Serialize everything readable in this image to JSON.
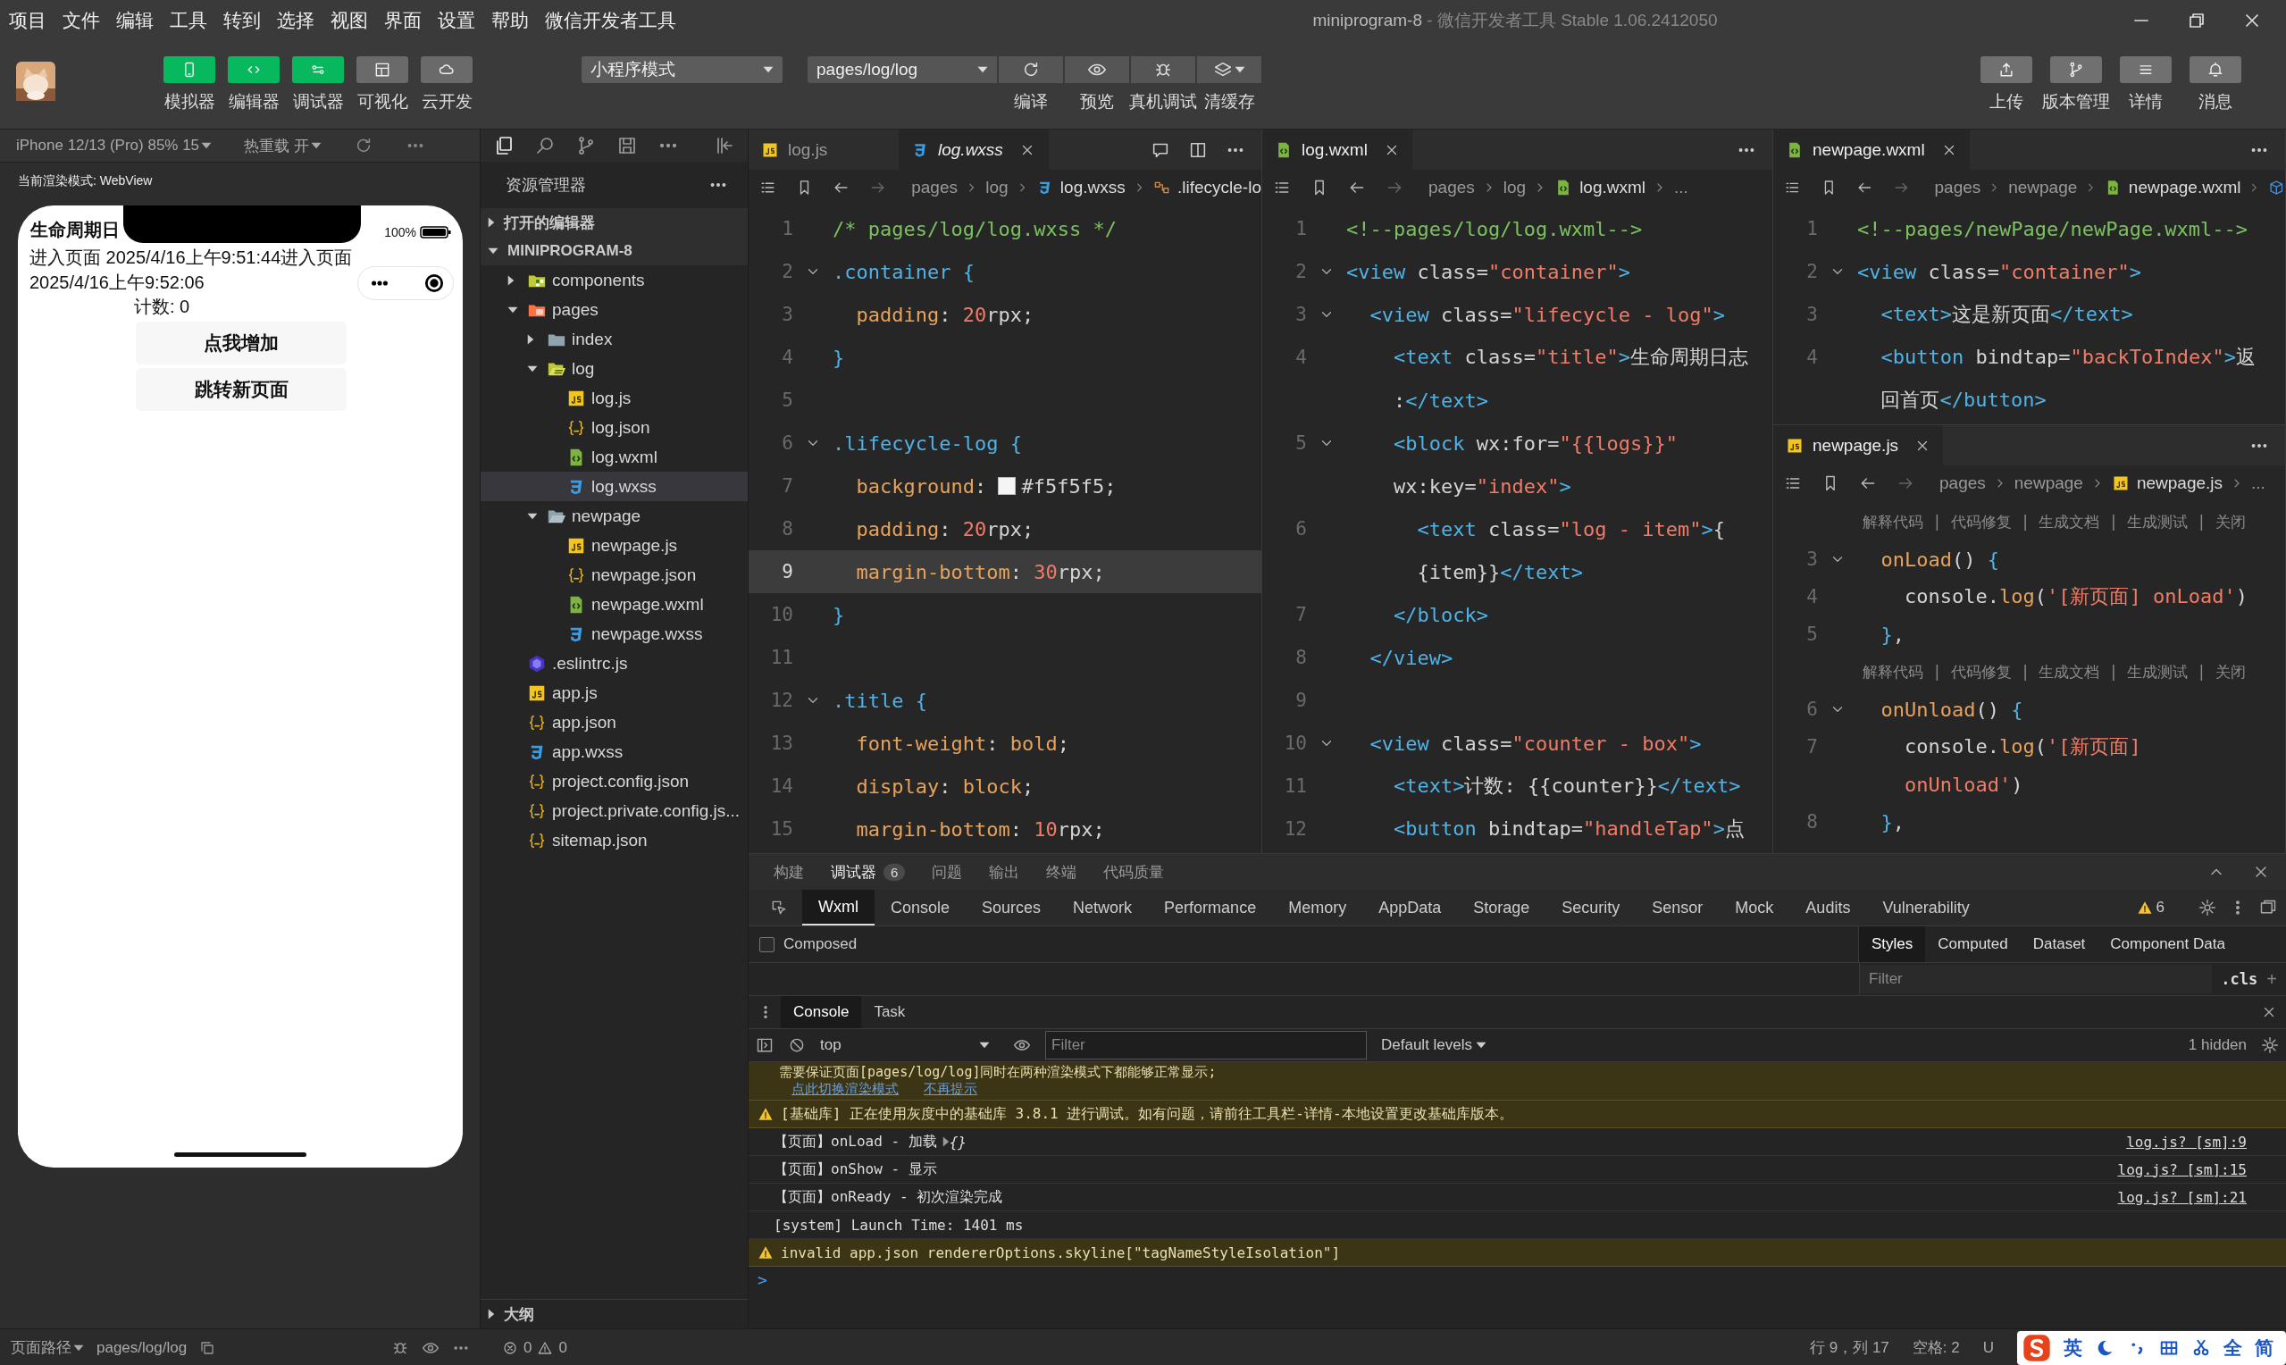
{
  "menu": [
    "项目",
    "文件",
    "编辑",
    "工具",
    "转到",
    "选择",
    "视图",
    "界面",
    "设置",
    "帮助",
    "微信开发者工具"
  ],
  "window": {
    "title": "miniprogram-8",
    "subtitle": " - 微信开发者工具 Stable 1.06.2412050"
  },
  "toolbar": {
    "tools": [
      {
        "label": "模拟器",
        "kind": "phone",
        "active": true
      },
      {
        "label": "编辑器",
        "kind": "code",
        "active": true
      },
      {
        "label": "调试器",
        "kind": "debug",
        "active": true
      },
      {
        "label": "可视化",
        "kind": "layout",
        "active": false
      },
      {
        "label": "云开发",
        "kind": "cloud",
        "active": false
      }
    ],
    "mode": "小程序模式",
    "page": "pages/log/log",
    "actions": [
      {
        "label": "编译",
        "kind": "refresh",
        "dropdown": false
      },
      {
        "label": "预览",
        "kind": "eye",
        "dropdown": false
      },
      {
        "label": "真机调试",
        "kind": "bug",
        "dropdown": false
      },
      {
        "label": "清缓存",
        "kind": "layers",
        "dropdown": true
      }
    ],
    "right": [
      {
        "label": "上传",
        "kind": "upload"
      },
      {
        "label": "版本管理",
        "kind": "branch"
      },
      {
        "label": "详情",
        "kind": "menu"
      },
      {
        "label": "消息",
        "kind": "bell"
      }
    ]
  },
  "simulator": {
    "device": "iPhone 12/13 (Pro) 85% 15",
    "hot_reload": "热重载 开",
    "render_mode": "当前渲染模式: WebView",
    "phone": {
      "title": "生命周期日",
      "battery": "100%",
      "log": "进入页面 2025/4/16上午9:51:44进入页面 2025/4/16上午9:52:06",
      "counter": "计数: 0",
      "buttons": [
        "点我增加",
        "跳转新页面"
      ]
    }
  },
  "explorer": {
    "title": "资源管理器",
    "sections": [
      {
        "label": "打开的编辑器",
        "expanded": false
      },
      {
        "label": "MINIPROGRAM-8",
        "expanded": true
      }
    ],
    "tree": [
      {
        "name": "components",
        "kind": "folder-components",
        "expanded": false,
        "selected": false
      },
      {
        "name": "pages",
        "kind": "folder-pages",
        "expanded": true,
        "selected": false,
        "children": [
          {
            "name": "index",
            "kind": "folder",
            "expanded": false,
            "selected": false
          },
          {
            "name": "log",
            "kind": "folder-logs",
            "expanded": true,
            "selected": false,
            "children": [
              {
                "name": "log.js",
                "kind": "js",
                "selected": false
              },
              {
                "name": "log.json",
                "kind": "json",
                "selected": false
              },
              {
                "name": "log.wxml",
                "kind": "wxml",
                "selected": false
              },
              {
                "name": "log.wxss",
                "kind": "wxss",
                "selected": true
              }
            ]
          },
          {
            "name": "newpage",
            "kind": "folder",
            "expanded": true,
            "selected": false,
            "children": [
              {
                "name": "newpage.js",
                "kind": "js",
                "selected": false
              },
              {
                "name": "newpage.json",
                "kind": "json",
                "selected": false
              },
              {
                "name": "newpage.wxml",
                "kind": "wxml",
                "selected": false
              },
              {
                "name": "newpage.wxss",
                "kind": "wxss",
                "selected": false
              }
            ]
          }
        ]
      },
      {
        "name": ".eslintrc.js",
        "kind": "eslint",
        "selected": false
      },
      {
        "name": "app.js",
        "kind": "js",
        "selected": false
      },
      {
        "name": "app.json",
        "kind": "json",
        "selected": false
      },
      {
        "name": "app.wxss",
        "kind": "wxss",
        "selected": false
      },
      {
        "name": "project.config.json",
        "kind": "json",
        "selected": false
      },
      {
        "name": "project.private.config.js...",
        "kind": "json",
        "selected": false
      },
      {
        "name": "sitemap.json",
        "kind": "json",
        "selected": false
      }
    ],
    "outline": {
      "label": "大纲",
      "expanded": false
    }
  },
  "editor_groups": [
    {
      "panes": [
        {
          "kind": "css",
          "tabs": [
            {
              "label": "log.js",
              "kind": "js",
              "selected": false,
              "preview": false,
              "closable": false
            },
            {
              "label": "log.wxss",
              "kind": "wxss",
              "selected": true,
              "preview": true,
              "closable": true
            }
          ],
          "breadcrumb": [
            {
              "text": "pages"
            },
            {
              "text": "log"
            },
            {
              "text": "log.wxss",
              "kind": "wxss"
            },
            {
              "text": ".lifecycle-lo",
              "kind": "symbol"
            }
          ],
          "lines": [
            {
              "n": "1",
              "fold": false,
              "current": false,
              "text": "/* pages/log/log.wxss */"
            },
            {
              "n": "2",
              "fold": true,
              "current": false,
              "text": ".container {"
            },
            {
              "n": "3",
              "fold": false,
              "current": false,
              "text": "  padding: 20rpx;"
            },
            {
              "n": "4",
              "fold": false,
              "current": false,
              "text": "}"
            },
            {
              "n": "5",
              "fold": false,
              "current": false
            },
            {
              "n": "6",
              "fold": true,
              "current": false,
              "text": ".lifecycle-log {"
            },
            {
              "n": "7",
              "fold": false,
              "current": false,
              "text": "  background: #f5f5f5;"
            },
            {
              "n": "8",
              "fold": false,
              "current": false,
              "text": "  padding: 20rpx;"
            },
            {
              "n": "9",
              "fold": false,
              "current": true,
              "text": "  margin-bottom: 30rpx;"
            },
            {
              "n": "10",
              "fold": false,
              "current": false,
              "text": "}"
            },
            {
              "n": "11",
              "fold": false,
              "current": false
            },
            {
              "n": "12",
              "fold": true,
              "current": false,
              "text": ".title {"
            },
            {
              "n": "13",
              "fold": false,
              "current": false,
              "text": "  font-weight: bold;"
            },
            {
              "n": "14",
              "fold": false,
              "current": false,
              "text": "  display: block;"
            },
            {
              "n": "15",
              "fold": false,
              "current": false,
              "text": "  margin-bottom: 10rpx;"
            }
          ]
        }
      ]
    },
    {
      "panes": [
        {
          "kind": "xml",
          "tabs": [
            {
              "label": "log.wxml",
              "kind": "wxml",
              "selected": true,
              "preview": false,
              "closable": true
            }
          ],
          "breadcrumb": [
            {
              "text": "pages"
            },
            {
              "text": "log"
            },
            {
              "text": "log.wxml",
              "kind": "wxml"
            },
            {
              "text": "..."
            }
          ],
          "lines": [
            {
              "n": "1",
              "fold": false,
              "text": "<!--pages/log/log.wxml-->"
            },
            {
              "n": "2",
              "fold": true,
              "text": "<view class=\"container\">"
            },
            {
              "n": "3",
              "fold": true,
              "text": "  <view class=\"lifecycle - log\">"
            },
            {
              "n": "4",
              "fold": false,
              "text": "    <text class=\"title\">生命周期日志"
            },
            {
              "fold": false,
              "text": "    :</text>"
            },
            {
              "n": "5",
              "fold": true,
              "text": "    <block wx:for=\"{{logs}}\""
            },
            {
              "fold": false,
              "text": "    wx:key=\"index\">"
            },
            {
              "n": "6",
              "fold": false,
              "text": "      <text class=\"log - item\">{"
            },
            {
              "fold": false,
              "text": "      {item}}</text>"
            },
            {
              "n": "7",
              "fold": false,
              "text": "    </block>"
            },
            {
              "n": "8",
              "fold": false,
              "text": "  </view>"
            },
            {
              "n": "9",
              "fold": false
            },
            {
              "n": "10",
              "fold": true,
              "text": "  <view class=\"counter - box\">"
            },
            {
              "n": "11",
              "fold": false,
              "text": "    <text>计数: {{counter}}</text>"
            },
            {
              "n": "12",
              "fold": false,
              "text": "    <button bindtap=\"handleTap\">点"
            }
          ]
        }
      ]
    },
    {
      "panes": [
        {
          "kind": "xml",
          "tabs": [
            {
              "label": "newpage.wxml",
              "kind": "wxml",
              "selected": true,
              "preview": false,
              "closable": true
            }
          ],
          "breadcrumb": [
            {
              "text": "pages"
            },
            {
              "text": "newpage"
            },
            {
              "text": "newpage.wxml",
              "kind": "wxml"
            },
            {
              "kind": "cube"
            }
          ],
          "lines": [
            {
              "n": "1",
              "fold": false,
              "text": "<!--pages/newPage/newPage.wxml-->"
            },
            {
              "n": "2",
              "fold": true,
              "text": "<view class=\"container\">"
            },
            {
              "n": "3",
              "fold": false,
              "text": "  <text>这是新页面</text>"
            },
            {
              "n": "4",
              "fold": false,
              "text": "  <button bindtap=\"backToIndex\">返"
            },
            {
              "fold": false,
              "text": "  回首页</button>"
            }
          ]
        },
        {
          "kind": "js",
          "tabs": [
            {
              "label": "newpage.js",
              "kind": "js",
              "selected": true,
              "preview": false,
              "closable": true
            }
          ],
          "breadcrumb": [
            {
              "text": "pages"
            },
            {
              "text": "newpage"
            },
            {
              "text": "newpage.js",
              "kind": "js"
            },
            {
              "text": "..."
            }
          ],
          "lines": [
            {
              "kind": "lens",
              "text": "解释代码 | 代码修复 | 生成文档 | 生成测试 | 关闭"
            },
            {
              "kind": "code",
              "n": "3",
              "fold": true,
              "text": "  onLoad() {"
            },
            {
              "kind": "code",
              "n": "4",
              "fold": false,
              "text": "    console.log('[新页面] onLoad')"
            },
            {
              "kind": "code",
              "n": "5",
              "fold": false,
              "text": "  },"
            },
            {
              "kind": "lens",
              "text": "解释代码 | 代码修复 | 生成文档 | 生成测试 | 关闭"
            },
            {
              "kind": "code",
              "n": "6",
              "fold": true,
              "text": "  onUnload() {"
            },
            {
              "kind": "code",
              "n": "7",
              "fold": false,
              "text": "    console.log('[新页面]"
            },
            {
              "kind": "code",
              "fold": false,
              "text": "    onUnload')"
            },
            {
              "kind": "code",
              "n": "8",
              "fold": false,
              "text": "  },"
            }
          ]
        }
      ]
    }
  ],
  "panel": {
    "tabs": [
      {
        "label": "构建",
        "selected": false
      },
      {
        "label": "调试器",
        "selected": true,
        "badge": "6"
      },
      {
        "label": "问题",
        "selected": false
      },
      {
        "label": "输出",
        "selected": false
      },
      {
        "label": "终端",
        "selected": false
      },
      {
        "label": "代码质量",
        "selected": false
      }
    ],
    "devtools": {
      "tabs": [
        {
          "label": "Wxml",
          "selected": true
        },
        {
          "label": "Console",
          "selected": false
        },
        {
          "label": "Sources",
          "selected": false
        },
        {
          "label": "Network",
          "selected": false
        },
        {
          "label": "Performance",
          "selected": false
        },
        {
          "label": "Memory",
          "selected": false
        },
        {
          "label": "AppData",
          "selected": false
        },
        {
          "label": "Storage",
          "selected": false
        },
        {
          "label": "Security",
          "selected": false
        },
        {
          "label": "Sensor",
          "selected": false
        },
        {
          "label": "Mock",
          "selected": false
        },
        {
          "label": "Audits",
          "selected": false
        },
        {
          "label": "Vulnerability",
          "selected": false
        }
      ],
      "warnings": "6",
      "composed": {
        "label": "Composed",
        "checked": false
      },
      "style_tabs": [
        {
          "label": "Styles",
          "selected": true
        },
        {
          "label": "Computed",
          "selected": false
        },
        {
          "label": "Dataset",
          "selected": false
        },
        {
          "label": "Component Data",
          "selected": false
        }
      ],
      "filter": {
        "placeholder": "Filter"
      },
      "cls": ".cls",
      "add": "+"
    },
    "drawer": {
      "tabs": [
        {
          "label": "Console",
          "selected": true
        },
        {
          "label": "Task",
          "selected": false
        }
      ],
      "context": "top",
      "filter": {
        "placeholder": "Filter"
      },
      "levels": "Default levels",
      "hidden": "1 hidden",
      "messages": [
        {
          "kind": "note",
          "text": "需要保证页面[pages/log/log]同时在两种渲染模式下都能够正常显示;",
          "links": [
            "点此切换渲染模式",
            "不再提示"
          ]
        },
        {
          "kind": "warn",
          "text": "[基础库] 正在使用灰度中的基础库 3.8.1 进行调试。如有问题，请前往工具栏-详情-本地设置更改基础库版本。"
        },
        {
          "kind": "log",
          "text": "【页面】onLoad - 加载 ",
          "object": "{}",
          "source": "log.js? [sm]:9"
        },
        {
          "kind": "log",
          "text": "【页面】onShow - 显示",
          "source": "log.js? [sm]:15"
        },
        {
          "kind": "log",
          "text": "【页面】onReady - 初次渲染完成",
          "source": "log.js? [sm]:21"
        },
        {
          "kind": "log",
          "text": "[system] Launch Time: 1401 ms"
        },
        {
          "kind": "warn",
          "text": "invalid app.json rendererOptions.skyline[\"tagNameStyleIsolation\"]"
        }
      ],
      "prompt": ">"
    }
  },
  "status": {
    "page_path": "页面路径",
    "page": "pages/log/log",
    "errors": "0",
    "warnings": "0",
    "position": "行 9，列 17",
    "indent": "空格: 2",
    "encoding": "U",
    "ime": {
      "lang": "英",
      "width": "全",
      "script": "简"
    }
  }
}
